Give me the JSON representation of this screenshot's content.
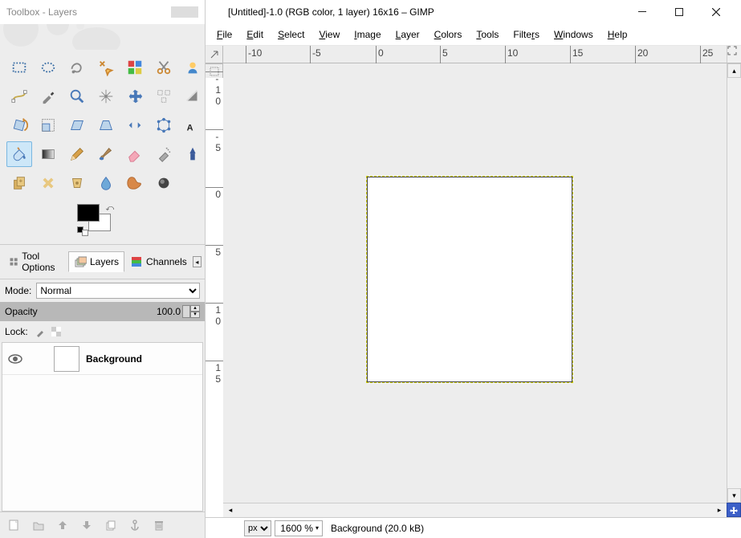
{
  "toolbox": {
    "title": "Toolbox - Layers",
    "tools": [
      "rect-select",
      "ellipse-select",
      "free-select",
      "fuzzy-select",
      "by-color-select",
      "scissors",
      "foreground-select",
      "paths",
      "color-picker",
      "zoom",
      "measure",
      "move",
      "align",
      "crop",
      "rotate",
      "scale",
      "shear",
      "perspective",
      "flip",
      "cage",
      "text",
      "bucket-fill",
      "blend",
      "pencil",
      "eraser",
      "airbrush",
      "ink",
      "clone",
      "heal",
      "perspective-clone",
      "blur",
      "smudge",
      "dodge"
    ],
    "selected_tool_index": 21,
    "tabs": {
      "tool_options": "Tool Options",
      "layers": "Layers",
      "channels": "Channels"
    },
    "mode_label": "Mode:",
    "mode_value": "Normal",
    "opacity_label": "Opacity",
    "opacity_value": "100.0",
    "lock_label": "Lock:",
    "layer": {
      "name": "Background"
    }
  },
  "image_window": {
    "title": "[Untitled]-1.0 (RGB color, 1 layer) 16x16 – GIMP",
    "menu": [
      "File",
      "Edit",
      "Select",
      "View",
      "Image",
      "Layer",
      "Colors",
      "Tools",
      "Filters",
      "Windows",
      "Help"
    ],
    "ruler_h": [
      {
        "pos": 28,
        "label": "-10"
      },
      {
        "pos": 108,
        "label": "-5"
      },
      {
        "pos": 190,
        "label": "0"
      },
      {
        "pos": 270,
        "label": "5"
      },
      {
        "pos": 351,
        "label": "10"
      },
      {
        "pos": 432,
        "label": "15"
      },
      {
        "pos": 513,
        "label": "20"
      },
      {
        "pos": 594,
        "label": "25"
      }
    ],
    "ruler_v": [
      {
        "pos": 10,
        "label": "-10"
      },
      {
        "pos": 82,
        "label": "-5"
      },
      {
        "pos": 154,
        "label": "0"
      },
      {
        "pos": 226,
        "label": "5"
      },
      {
        "pos": 298,
        "label": "10"
      },
      {
        "pos": 370,
        "label": "15"
      }
    ],
    "status": {
      "unit": "px",
      "zoom": "1600 %",
      "layer_status": "Background (20.0 kB)"
    }
  }
}
